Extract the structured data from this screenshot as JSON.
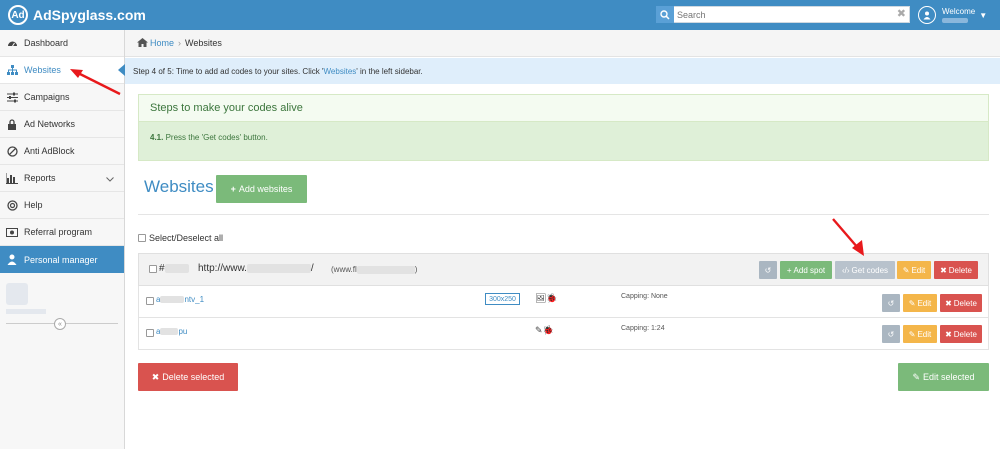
{
  "app": {
    "logo_text": "AdSpyglass.com"
  },
  "search": {
    "placeholder": "Search"
  },
  "header": {
    "welcome": "Welcome"
  },
  "sidebar": {
    "items": [
      {
        "label": "Dashboard",
        "icon": "dashboard-icon"
      },
      {
        "label": "Websites",
        "icon": "sitemap-icon",
        "active": true
      },
      {
        "label": "Campaigns",
        "icon": "sliders-icon"
      },
      {
        "label": "Ad Networks",
        "icon": "lock-icon"
      },
      {
        "label": "Anti AdBlock",
        "icon": "ban-icon"
      },
      {
        "label": "Reports",
        "icon": "bar-chart-icon",
        "has_submenu": true
      },
      {
        "label": "Help",
        "icon": "lifebuoy-icon"
      },
      {
        "label": "Referral program",
        "icon": "money-icon"
      }
    ],
    "manager": {
      "label": "Personal manager",
      "icon": "user-icon"
    }
  },
  "breadcrumb": {
    "home": "Home",
    "current": "Websites"
  },
  "step_notice": {
    "prefix": "Step 4 of 5: Time to add ad codes to your sites. Click '",
    "link": "Websites",
    "suffix": "' in the left sidebar."
  },
  "steps_box": {
    "title": "Steps to make your codes alive",
    "step_num": "4.1.",
    "step_text": "Press the 'Get codes' button."
  },
  "page": {
    "title": "Websites",
    "add_websites": "Add websites",
    "select_all": "Select/Deselect all"
  },
  "site": {
    "id_prefix": "#",
    "url_prefix": "http://www.",
    "url_suffix": "/",
    "domain_prefix": "(www.fl",
    "domain_suffix": ")",
    "actions": {
      "add_spot": "Add spot",
      "get_codes": "Get codes",
      "edit": "Edit",
      "delete": "Delete"
    }
  },
  "spots": [
    {
      "name_prefix": "a",
      "name_suffix": "ntv_1",
      "size": "300x250",
      "icons": "🖼🐞",
      "capping": "Capping: None",
      "edit": "Edit",
      "delete": "Delete"
    },
    {
      "name_prefix": "a",
      "name_suffix": "pu",
      "size": "",
      "icons": "✎🐞",
      "capping": "Capping: 1:24",
      "edit": "Edit",
      "delete": "Delete"
    }
  ],
  "bottom": {
    "delete_selected": "Delete selected",
    "edit_selected": "Edit selected"
  },
  "colors": {
    "brand": "#3f8cc3",
    "success": "#7bba7a",
    "danger": "#d9534f",
    "warning": "#f4b64a",
    "annotation_arrow": "#e8191c"
  }
}
